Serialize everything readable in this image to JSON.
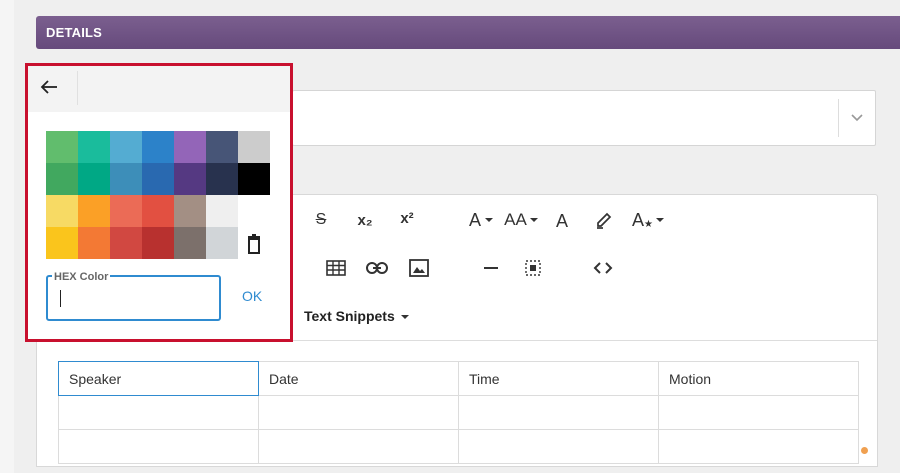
{
  "header": {
    "title": "DETAILS"
  },
  "editor": {
    "text_snippets_label": "Text Snippets",
    "toolbar": {
      "strikethrough": "S",
      "subscript": "x₂",
      "superscript": "x²",
      "font_color": "A",
      "font_size": "AA",
      "background_color": "A",
      "clear_format": "A"
    }
  },
  "table": {
    "headers": [
      "Speaker",
      "Date",
      "Time",
      "Motion"
    ]
  },
  "color_popup": {
    "swatches": [
      "#61bd6d",
      "#1abc9c",
      "#54acd2",
      "#2c82c9",
      "#9365b8",
      "#475577",
      "#cccccc",
      "#41a85f",
      "#00a885",
      "#3d8eb9",
      "#2969b0",
      "#553982",
      "#28324e",
      "#000000",
      "#f7da64",
      "#fba026",
      "#eb6b56",
      "#e25041",
      "#a38f84",
      "#efefef",
      "#ffffff",
      "#fac51c",
      "#f37934",
      "#d14841",
      "#b8312f",
      "#7c706b",
      "#d1d5d8",
      "REMOVE"
    ],
    "hex_label": "HEX Color",
    "hex_value": "",
    "ok_label": "OK"
  },
  "colors": {
    "accent": "#2f8bd0",
    "highlight_border": "#c8102e",
    "header_bg": "#704f86"
  }
}
